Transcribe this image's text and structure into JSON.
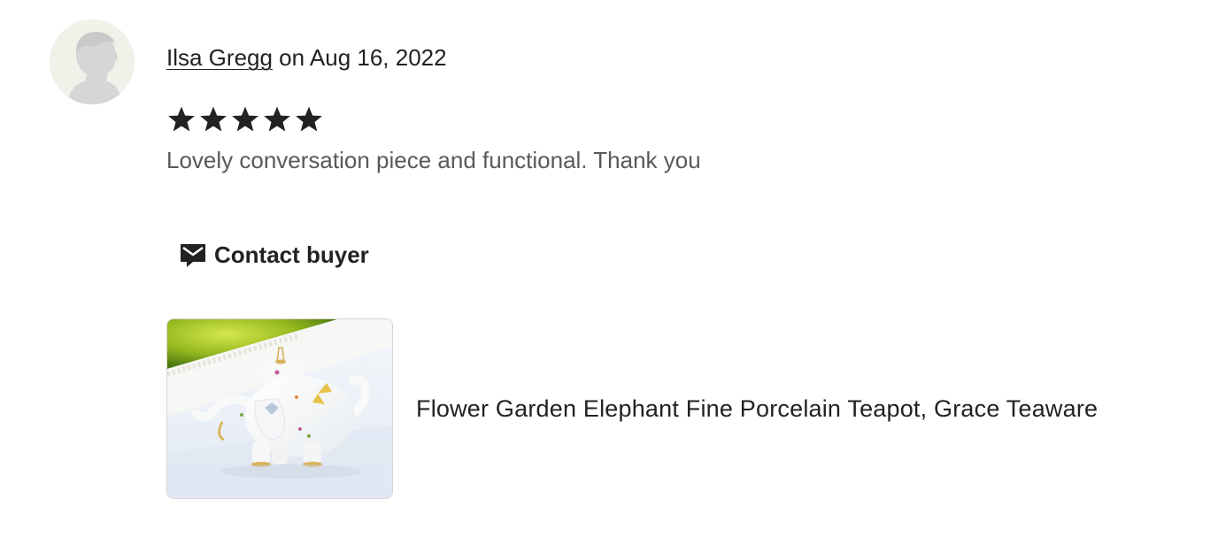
{
  "review": {
    "reviewer_name": "Ilsa Gregg",
    "date_text": " on Aug 16, 2022",
    "rating": 5,
    "rating_max": 5,
    "text": "Lovely conversation piece and functional. Thank you"
  },
  "actions": {
    "contact_label": "Contact buyer",
    "contact_icon": "message-icon"
  },
  "product": {
    "title": "Flower Garden Elephant Fine Porcelain Teapot, Grace Teaware"
  },
  "colors": {
    "text": "#222222",
    "muted_text": "#595959",
    "avatar_bg": "#f1f1ea",
    "star": "#222222"
  }
}
